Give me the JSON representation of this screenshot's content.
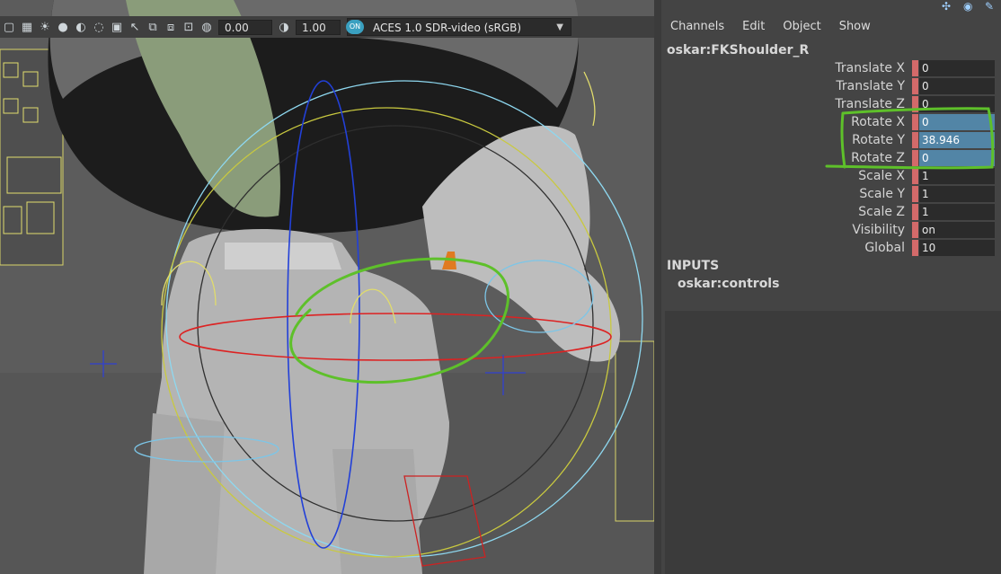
{
  "viewport": {
    "toolbar": {
      "exposure_value": "0.00",
      "gamma_value": "1.00",
      "colorspace_toggle": "ON",
      "colorspace": "ACES 1.0 SDR-video (sRGB)",
      "icons": [
        "cube-icon",
        "checker-icon",
        "light-icon",
        "shade-icon",
        "wire-icon",
        "isolate-icon",
        "grid-icon",
        "cursor-icon",
        "copy-icon",
        "paste-icon",
        "frame-icon",
        "exposure-icon",
        "gamma-icon"
      ]
    }
  },
  "channel_box": {
    "menu": [
      "Channels",
      "Edit",
      "Object",
      "Show"
    ],
    "node_name": "oskar:FKShoulder_R",
    "attributes": [
      {
        "label": "Translate X",
        "value": "0",
        "selected": false
      },
      {
        "label": "Translate Y",
        "value": "0",
        "selected": false
      },
      {
        "label": "Translate Z",
        "value": "0",
        "selected": false
      },
      {
        "label": "Rotate X",
        "value": "0",
        "selected": true
      },
      {
        "label": "Rotate Y",
        "value": "38.946",
        "selected": true
      },
      {
        "label": "Rotate Z",
        "value": "0",
        "selected": true
      },
      {
        "label": "Scale X",
        "value": "1",
        "selected": false
      },
      {
        "label": "Scale Y",
        "value": "1",
        "selected": false
      },
      {
        "label": "Scale Z",
        "value": "1",
        "selected": false
      },
      {
        "label": "Visibility",
        "value": "on",
        "selected": false
      },
      {
        "label": "Global",
        "value": "10",
        "selected": false
      }
    ],
    "inputs_header": "INPUTS",
    "inputs_node": "oskar:controls"
  },
  "colors": {
    "annotation": "#5ec02a",
    "selection": "#5285a6",
    "keyed": "#d36a6a"
  }
}
